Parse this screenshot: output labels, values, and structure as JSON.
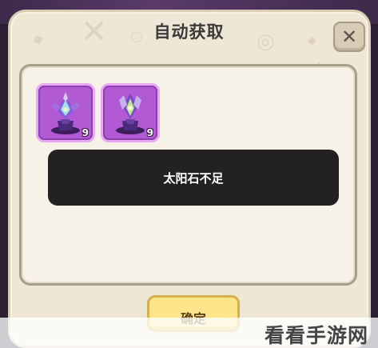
{
  "dialog": {
    "title": "自动获取",
    "close_label": "✕",
    "items": [
      {
        "name": "purple-crystal-statue-a",
        "count": "9"
      },
      {
        "name": "purple-crystal-statue-b",
        "count": "9"
      }
    ],
    "toast": "太阳石不足",
    "confirm_label": "确定"
  },
  "watermark": "看看手游网",
  "colors": {
    "dialog_bg": "#efe7d6",
    "item_bg": "#b25ad4",
    "toast_bg": "#232121",
    "confirm_bg": "#ffe58a"
  }
}
